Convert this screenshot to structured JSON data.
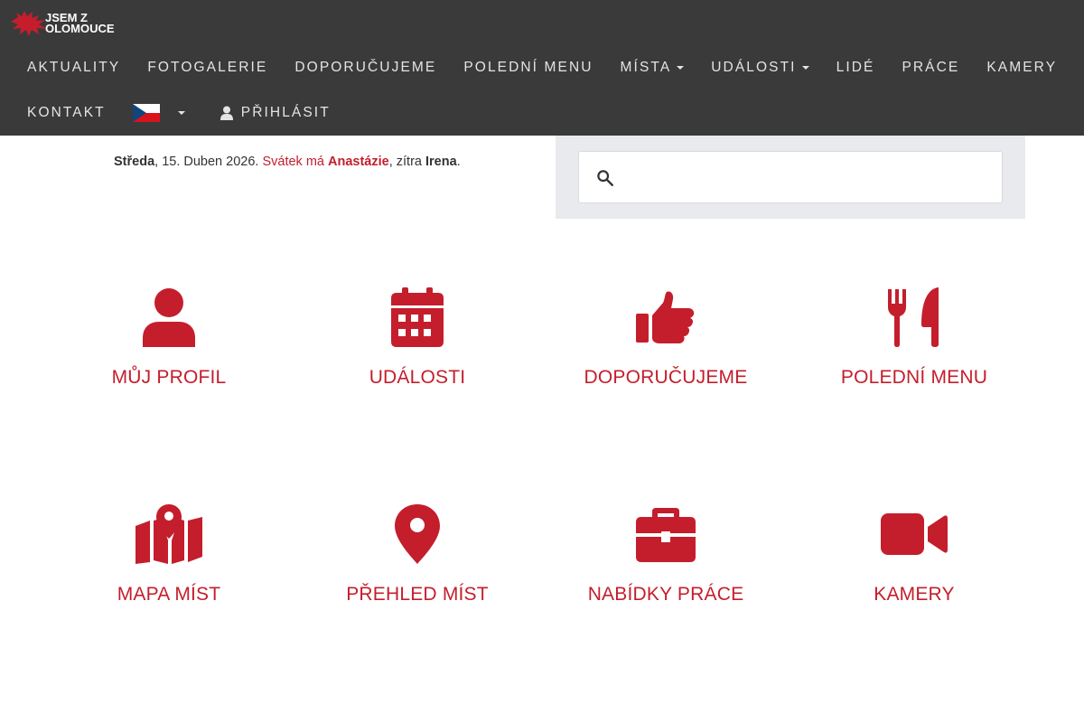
{
  "brand": {
    "line1": "JSEM Z",
    "line2": "OLOMOUCE",
    "accent": "#c41e2c"
  },
  "nav": {
    "items": [
      {
        "label": "AKTUALITY"
      },
      {
        "label": "FOTOGALERIE"
      },
      {
        "label": "DOPORUČUJEME"
      },
      {
        "label": "POLEDNÍ MENU"
      },
      {
        "label": "MÍSTA"
      },
      {
        "label": "UDÁLOSTI"
      },
      {
        "label": "LIDÉ"
      },
      {
        "label": "PRÁCE"
      },
      {
        "label": "KAMERY"
      },
      {
        "label": "KONTAKT"
      }
    ],
    "language": "czech-flag-icon",
    "login": "PŘIHLÁSIT"
  },
  "today": {
    "day": "Středa",
    "date": ", 15. Duben 2026. ",
    "nameday_prefix": "Svátek má ",
    "name_today": "Anastázie",
    "tomorrow_prefix": ", zítra ",
    "name_tomorrow": "Irena",
    "end": "."
  },
  "search": {
    "placeholder": "",
    "value": ""
  },
  "tiles": [
    {
      "label": "MŮJ PROFIL",
      "icon": "user-icon"
    },
    {
      "label": "UDÁLOSTI",
      "icon": "calendar-icon"
    },
    {
      "label": "DOPORUČUJEME",
      "icon": "thumbs-up-icon"
    },
    {
      "label": "POLEDNÍ MENU",
      "icon": "fork-knife-icon"
    },
    {
      "label": "MAPA MÍST",
      "icon": "map-icon"
    },
    {
      "label": "PŘEHLED MÍST",
      "icon": "map-marker-icon"
    },
    {
      "label": "NABÍDKY PRÁCE",
      "icon": "briefcase-icon"
    },
    {
      "label": "KAMERY",
      "icon": "video-camera-icon"
    }
  ]
}
